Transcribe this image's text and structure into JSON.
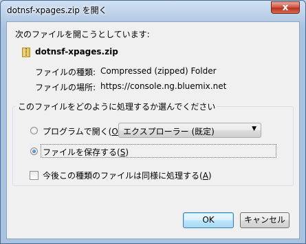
{
  "window": {
    "title": "dotnsf-xpages.zip を開く",
    "close_label": "x"
  },
  "dialog": {
    "intro": "次のファイルを開こうとしています:",
    "file_name": "dotnsf-xpages.zip",
    "type_label": "ファイルの種類:",
    "type_value": "Compressed (zipped) Folder",
    "source_label": "ファイルの場所:",
    "source_value": "https://console.ng.bluemix.net",
    "group_title": "このファイルをどのように処理するか選んでください",
    "open_with": {
      "label_prefix": "プログラムで開く(",
      "accesskey": "O",
      "label_suffix": "):",
      "selected": false,
      "selected_program": "エクスプローラー (既定)"
    },
    "save_file": {
      "label_prefix": "ファイルを保存する(",
      "accesskey": "S",
      "label_suffix": ")",
      "selected": true
    },
    "remember": {
      "label_prefix": "今後この種類のファイルは同様に処理する(",
      "accesskey": "A",
      "label_suffix": ")",
      "checked": false
    }
  },
  "buttons": {
    "ok": "OK",
    "cancel": "キャンセル"
  }
}
